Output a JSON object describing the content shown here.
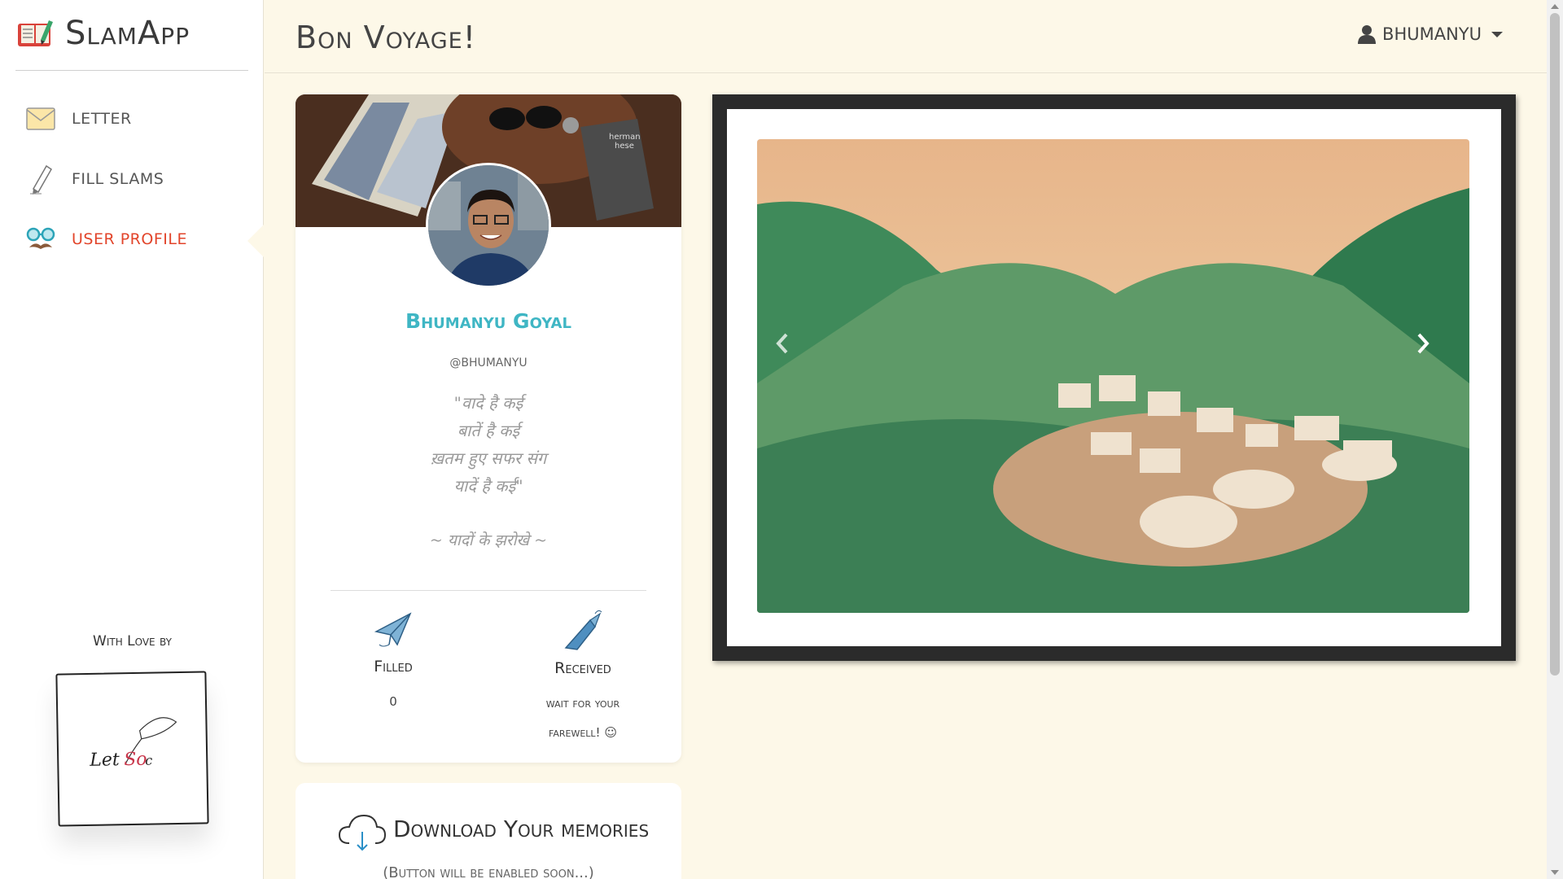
{
  "app": {
    "name": "SlamApp"
  },
  "sidebar": {
    "items": [
      {
        "label": "Letter",
        "icon": "envelope-icon",
        "active": false
      },
      {
        "label": "Fill Slams",
        "icon": "pencil-icon",
        "active": false
      },
      {
        "label": "User Profile",
        "icon": "glasses-mustache-icon",
        "active": true
      }
    ],
    "footer": {
      "label": "With Love by",
      "signature": "LetSoc"
    }
  },
  "header": {
    "title": "Bon Voyage!",
    "user": "BHUMANYU",
    "user_icon": "user-icon"
  },
  "profile": {
    "name": "Bhumanyu Goyal",
    "handle": "@BHUMANYU",
    "quote_lines": [
      "\"वादे है कई",
      "बातें है कई",
      "ख़तम हुए सफर संग",
      "यादें है कई\""
    ],
    "quote_sign": "~ यादों के झरोखे ~",
    "stats": {
      "filled_label": "Filled",
      "filled_value": "0",
      "received_label": "Received",
      "received_value_line1": "wait for your",
      "received_value_line2": "farewell! ☺"
    }
  },
  "download": {
    "title": "Download Your memories",
    "subtitle": "(Button will be enabled soon...)"
  },
  "colors": {
    "accent_active": "#e2452b",
    "name_color": "#3fb6c4",
    "background": "#fdf8e8"
  }
}
